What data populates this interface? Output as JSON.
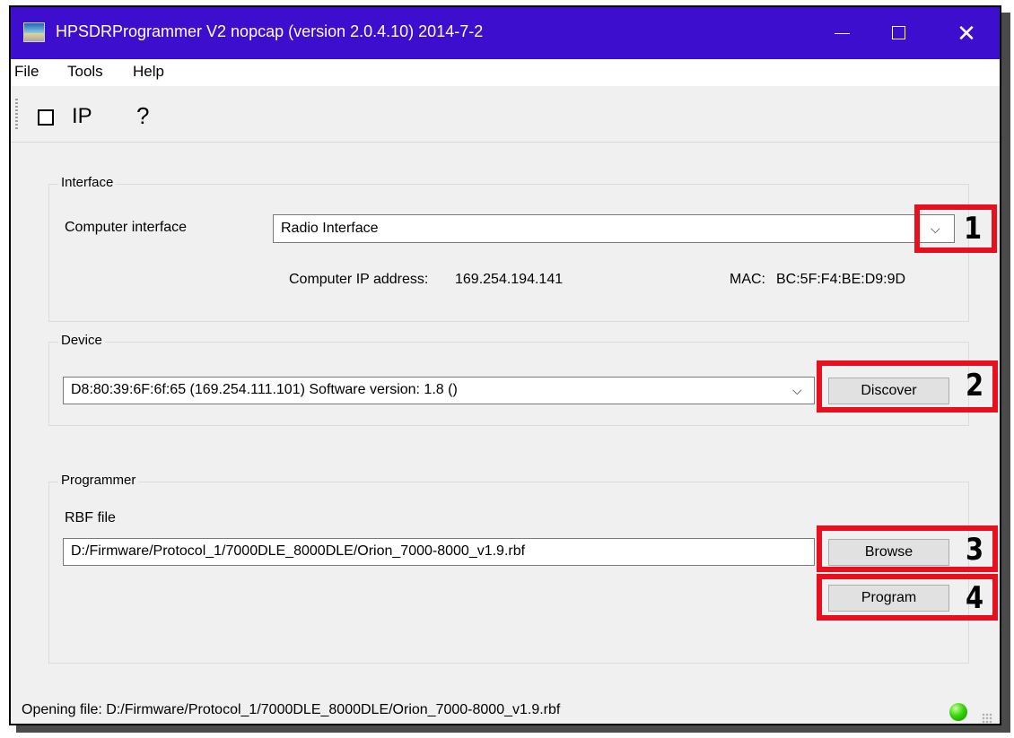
{
  "window": {
    "title": "HPSDRProgrammer V2 nopcap (version 2.0.4.10) 2014-7-2",
    "minimize_icon": "minimize-icon",
    "maximize_icon": "maximize-icon",
    "close_symbol": "✕"
  },
  "menu": [
    "File",
    "Tools",
    "Help"
  ],
  "toolbar": {
    "ip_label": "IP",
    "help_label": "?"
  },
  "interface": {
    "title": "Interface",
    "computer_interface_label": "Computer interface",
    "selected": "Radio Interface",
    "ip_label": "Computer IP address:",
    "ip_value": "169.254.194.141",
    "mac_label": "MAC:",
    "mac_value": "BC:5F:F4:BE:D9:9D"
  },
  "device": {
    "title": "Device",
    "selected": "D8:80:39:6F:6f:65 (169.254.111.101) Software version: 1.8 ()",
    "discover_label": "Discover"
  },
  "programmer": {
    "title": "Programmer",
    "rbf_label": "RBF file",
    "rbf_path": "D:/Firmware/Protocol_1/7000DLE_8000DLE/Orion_7000-8000_v1.9.rbf",
    "browse_label": "Browse",
    "program_label": "Program"
  },
  "annotations": [
    "1",
    "2",
    "3",
    "4"
  ],
  "colors": {
    "titlebar": "#3e0ecf",
    "annotation_red": "#e8101e",
    "led_green": "#39d40a"
  },
  "status": {
    "text": "Opening file: D:/Firmware/Protocol_1/7000DLE_8000DLE/Orion_7000-8000_v1.9.rbf"
  }
}
